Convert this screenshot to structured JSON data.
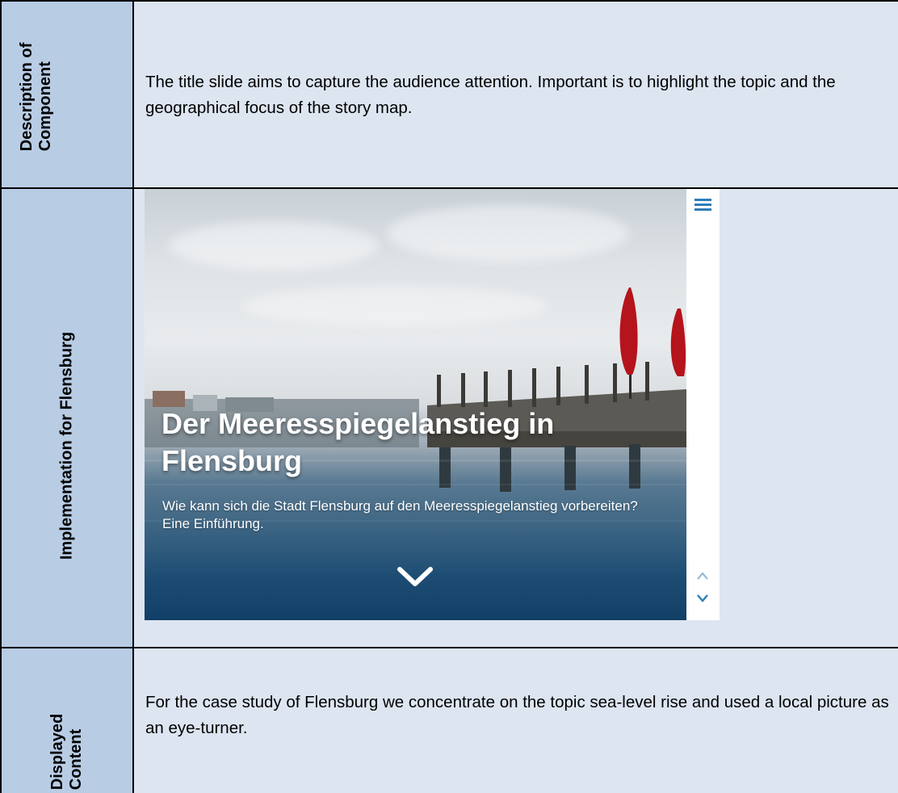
{
  "rows": [
    {
      "header": "Description of Component",
      "header_line1": "Description of",
      "header_line2": "Component",
      "text": "The title slide aims to capture the audience attention. Important is to highlight the topic and the geographical focus of the story map."
    },
    {
      "header": "Implementation for Flensburg"
    },
    {
      "header_line1": "Displayed",
      "header_line2": "Content",
      "text": "For the case study of Flensburg we concentrate on the topic sea-level rise and used a local picture as an eye-turner."
    }
  ],
  "story_map": {
    "title": "Der Meeresspiegelanstieg in Flensburg",
    "subtitle": "Wie kann sich die Stadt Flensburg auf den Meeresspiegelanstieg vorbereiten? Eine Einführung.",
    "icons": {
      "menu": "menu-icon",
      "scroll_down": "chevron-down-icon",
      "nav_up": "chevron-up-icon",
      "nav_down": "chevron-down-icon"
    },
    "accent_color": "#2f7db6"
  },
  "colors": {
    "header_fill": "#b8cce4",
    "cell_fill": "#dde5f1",
    "border": "#000000"
  }
}
